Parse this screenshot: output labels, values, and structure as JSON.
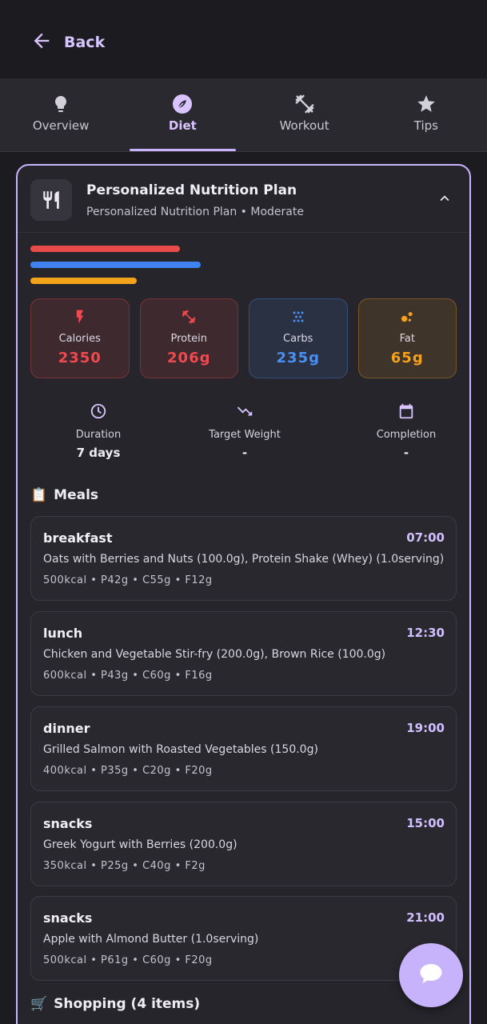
{
  "header": {
    "back_label": "Back"
  },
  "tabs": [
    {
      "label": "Overview",
      "icon": "lightbulb-icon"
    },
    {
      "label": "Diet",
      "icon": "leaf-icon"
    },
    {
      "label": "Workout",
      "icon": "dumbbell-icon"
    },
    {
      "label": "Tips",
      "icon": "star-icon"
    }
  ],
  "active_tab": "Diet",
  "plan": {
    "title": "Personalized Nutrition Plan",
    "subtitle": "Personalized Nutrition Plan • Moderate",
    "progress_bars": [
      {
        "color": "#e94b4b",
        "fraction": 0.35
      },
      {
        "color": "#3f82f0",
        "fraction": 0.4
      },
      {
        "color": "#f3a319",
        "fraction": 0.25
      }
    ]
  },
  "macros": [
    {
      "label": "Calories",
      "value": "2350",
      "color": "#ef4a4f",
      "icon": "bolt-icon"
    },
    {
      "label": "Protein",
      "value": "206g",
      "color": "#ef4a4f",
      "icon": "fitness-icon"
    },
    {
      "label": "Carbs",
      "value": "235g",
      "color": "#4a8ff2",
      "icon": "grain-icon"
    },
    {
      "label": "Fat",
      "value": "65g",
      "color": "#f4a21d",
      "icon": "bubbles-icon"
    }
  ],
  "stats": [
    {
      "label": "Duration",
      "value": "7 days",
      "icon": "clock-icon"
    },
    {
      "label": "Target Weight",
      "value": "-",
      "icon": "trending-down-icon"
    },
    {
      "label": "Completion",
      "value": "-",
      "icon": "calendar-icon"
    }
  ],
  "meals_section": {
    "emoji": "📋",
    "title": "Meals"
  },
  "meals": [
    {
      "name": "breakfast",
      "time": "07:00",
      "items": "Oats with Berries and Nuts (100.0g), Protein Shake (Whey) (1.0serving)",
      "macros": "500kcal • P42g • C55g • F12g"
    },
    {
      "name": "lunch",
      "time": "12:30",
      "items": "Chicken and Vegetable Stir-fry (200.0g), Brown Rice (100.0g)",
      "macros": "600kcal • P43g • C60g • F16g"
    },
    {
      "name": "dinner",
      "time": "19:00",
      "items": "Grilled Salmon with Roasted Vegetables (150.0g)",
      "macros": "400kcal • P35g • C20g • F20g"
    },
    {
      "name": "snacks",
      "time": "15:00",
      "items": "Greek Yogurt with Berries (200.0g)",
      "macros": "350kcal • P25g • C40g • F2g"
    },
    {
      "name": "snacks",
      "time": "21:00",
      "items": "Apple with Almond Butter (1.0serving)",
      "macros": "500kcal • P61g • C60g • F20g"
    }
  ],
  "shopping_section": {
    "emoji": "🛒",
    "title": "Shopping (4 items)"
  }
}
